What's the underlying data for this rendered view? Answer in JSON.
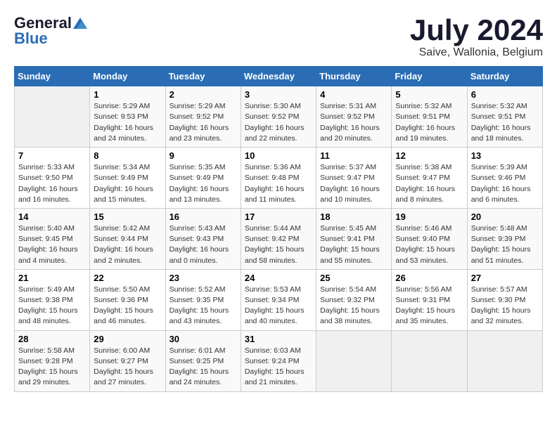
{
  "logo": {
    "general": "General",
    "blue": "Blue"
  },
  "title": "July 2024",
  "location": "Saive, Wallonia, Belgium",
  "days_header": [
    "Sunday",
    "Monday",
    "Tuesday",
    "Wednesday",
    "Thursday",
    "Friday",
    "Saturday"
  ],
  "weeks": [
    [
      {
        "day": "",
        "info": ""
      },
      {
        "day": "1",
        "info": "Sunrise: 5:29 AM\nSunset: 9:53 PM\nDaylight: 16 hours\nand 24 minutes."
      },
      {
        "day": "2",
        "info": "Sunrise: 5:29 AM\nSunset: 9:52 PM\nDaylight: 16 hours\nand 23 minutes."
      },
      {
        "day": "3",
        "info": "Sunrise: 5:30 AM\nSunset: 9:52 PM\nDaylight: 16 hours\nand 22 minutes."
      },
      {
        "day": "4",
        "info": "Sunrise: 5:31 AM\nSunset: 9:52 PM\nDaylight: 16 hours\nand 20 minutes."
      },
      {
        "day": "5",
        "info": "Sunrise: 5:32 AM\nSunset: 9:51 PM\nDaylight: 16 hours\nand 19 minutes."
      },
      {
        "day": "6",
        "info": "Sunrise: 5:32 AM\nSunset: 9:51 PM\nDaylight: 16 hours\nand 18 minutes."
      }
    ],
    [
      {
        "day": "7",
        "info": "Sunrise: 5:33 AM\nSunset: 9:50 PM\nDaylight: 16 hours\nand 16 minutes."
      },
      {
        "day": "8",
        "info": "Sunrise: 5:34 AM\nSunset: 9:49 PM\nDaylight: 16 hours\nand 15 minutes."
      },
      {
        "day": "9",
        "info": "Sunrise: 5:35 AM\nSunset: 9:49 PM\nDaylight: 16 hours\nand 13 minutes."
      },
      {
        "day": "10",
        "info": "Sunrise: 5:36 AM\nSunset: 9:48 PM\nDaylight: 16 hours\nand 11 minutes."
      },
      {
        "day": "11",
        "info": "Sunrise: 5:37 AM\nSunset: 9:47 PM\nDaylight: 16 hours\nand 10 minutes."
      },
      {
        "day": "12",
        "info": "Sunrise: 5:38 AM\nSunset: 9:47 PM\nDaylight: 16 hours\nand 8 minutes."
      },
      {
        "day": "13",
        "info": "Sunrise: 5:39 AM\nSunset: 9:46 PM\nDaylight: 16 hours\nand 6 minutes."
      }
    ],
    [
      {
        "day": "14",
        "info": "Sunrise: 5:40 AM\nSunset: 9:45 PM\nDaylight: 16 hours\nand 4 minutes."
      },
      {
        "day": "15",
        "info": "Sunrise: 5:42 AM\nSunset: 9:44 PM\nDaylight: 16 hours\nand 2 minutes."
      },
      {
        "day": "16",
        "info": "Sunrise: 5:43 AM\nSunset: 9:43 PM\nDaylight: 16 hours\nand 0 minutes."
      },
      {
        "day": "17",
        "info": "Sunrise: 5:44 AM\nSunset: 9:42 PM\nDaylight: 15 hours\nand 58 minutes."
      },
      {
        "day": "18",
        "info": "Sunrise: 5:45 AM\nSunset: 9:41 PM\nDaylight: 15 hours\nand 55 minutes."
      },
      {
        "day": "19",
        "info": "Sunrise: 5:46 AM\nSunset: 9:40 PM\nDaylight: 15 hours\nand 53 minutes."
      },
      {
        "day": "20",
        "info": "Sunrise: 5:48 AM\nSunset: 9:39 PM\nDaylight: 15 hours\nand 51 minutes."
      }
    ],
    [
      {
        "day": "21",
        "info": "Sunrise: 5:49 AM\nSunset: 9:38 PM\nDaylight: 15 hours\nand 48 minutes."
      },
      {
        "day": "22",
        "info": "Sunrise: 5:50 AM\nSunset: 9:36 PM\nDaylight: 15 hours\nand 46 minutes."
      },
      {
        "day": "23",
        "info": "Sunrise: 5:52 AM\nSunset: 9:35 PM\nDaylight: 15 hours\nand 43 minutes."
      },
      {
        "day": "24",
        "info": "Sunrise: 5:53 AM\nSunset: 9:34 PM\nDaylight: 15 hours\nand 40 minutes."
      },
      {
        "day": "25",
        "info": "Sunrise: 5:54 AM\nSunset: 9:32 PM\nDaylight: 15 hours\nand 38 minutes."
      },
      {
        "day": "26",
        "info": "Sunrise: 5:56 AM\nSunset: 9:31 PM\nDaylight: 15 hours\nand 35 minutes."
      },
      {
        "day": "27",
        "info": "Sunrise: 5:57 AM\nSunset: 9:30 PM\nDaylight: 15 hours\nand 32 minutes."
      }
    ],
    [
      {
        "day": "28",
        "info": "Sunrise: 5:58 AM\nSunset: 9:28 PM\nDaylight: 15 hours\nand 29 minutes."
      },
      {
        "day": "29",
        "info": "Sunrise: 6:00 AM\nSunset: 9:27 PM\nDaylight: 15 hours\nand 27 minutes."
      },
      {
        "day": "30",
        "info": "Sunrise: 6:01 AM\nSunset: 9:25 PM\nDaylight: 15 hours\nand 24 minutes."
      },
      {
        "day": "31",
        "info": "Sunrise: 6:03 AM\nSunset: 9:24 PM\nDaylight: 15 hours\nand 21 minutes."
      },
      {
        "day": "",
        "info": ""
      },
      {
        "day": "",
        "info": ""
      },
      {
        "day": "",
        "info": ""
      }
    ]
  ]
}
